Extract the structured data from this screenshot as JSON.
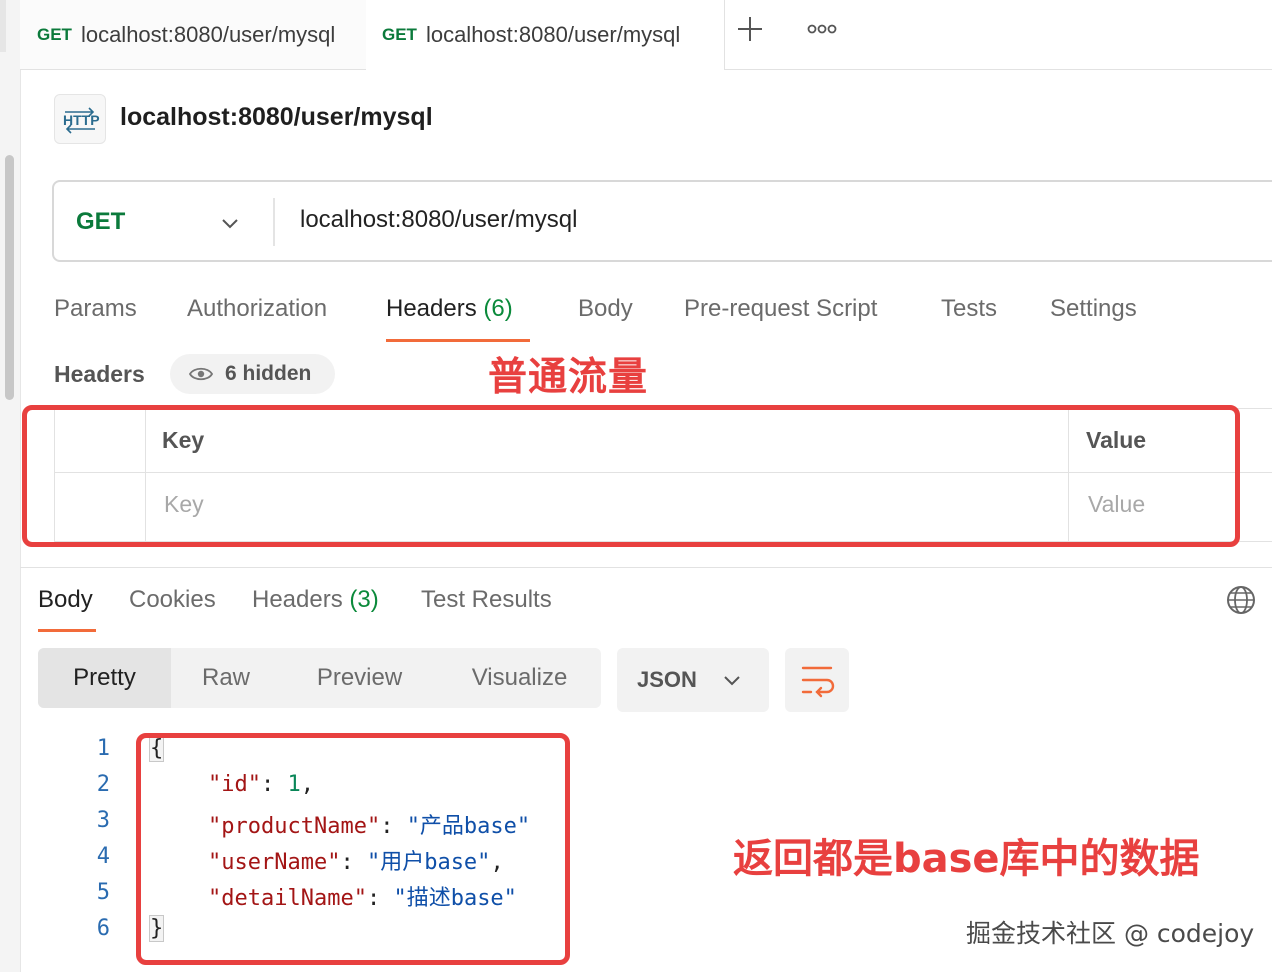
{
  "tabs": [
    {
      "method": "GET",
      "url": "localhost:8080/user/mysql"
    },
    {
      "method": "GET",
      "url": "localhost:8080/user/mysql"
    }
  ],
  "tabbar": {
    "new_tab_icon": "plus-icon",
    "more_icon": "more-icon"
  },
  "request": {
    "badge_icon": "http-icon",
    "title": "localhost:8080/user/mysql",
    "method": "GET",
    "url": "localhost:8080/user/mysql"
  },
  "request_tabs": [
    {
      "label": "Params"
    },
    {
      "label": "Authorization"
    },
    {
      "label": "Headers",
      "count": "(6)"
    },
    {
      "label": "Body"
    },
    {
      "label": "Pre-request Script"
    },
    {
      "label": "Tests"
    },
    {
      "label": "Settings"
    }
  ],
  "headers_section": {
    "label": "Headers",
    "hidden": "6 hidden",
    "key_header": "Key",
    "value_header": "Value",
    "key_placeholder": "Key",
    "value_placeholder": "Value"
  },
  "annotations": {
    "normal_traffic": "普通流量",
    "returns_base": "返回都是base库中的数据"
  },
  "response_tabs": [
    {
      "label": "Body"
    },
    {
      "label": "Cookies"
    },
    {
      "label": "Headers",
      "count": "(3)"
    },
    {
      "label": "Test Results"
    }
  ],
  "view_modes": [
    "Pretty",
    "Raw",
    "Preview",
    "Visualize"
  ],
  "format": "JSON",
  "code": {
    "line_numbers": [
      "1",
      "2",
      "3",
      "4",
      "5",
      "6"
    ],
    "open_brace": "{",
    "close_brace": "}",
    "fields": [
      {
        "key": "\"id\"",
        "sep": ": ",
        "value": "1",
        "trail": ","
      },
      {
        "key": "\"productName\"",
        "sep": ": ",
        "value": "\"产品base\"",
        "trail": ""
      },
      {
        "key": "\"userName\"",
        "sep": ": ",
        "value": "\"用户base\"",
        "trail": ","
      },
      {
        "key": "\"detailName\"",
        "sep": ": ",
        "value": "\"描述base\"",
        "trail": ""
      }
    ]
  },
  "watermark": "掘金技术社区 @ codejoy",
  "colors": {
    "accent": "#f26b3a",
    "get_method": "#0b7a3b",
    "annotation_red": "#e8403f"
  }
}
